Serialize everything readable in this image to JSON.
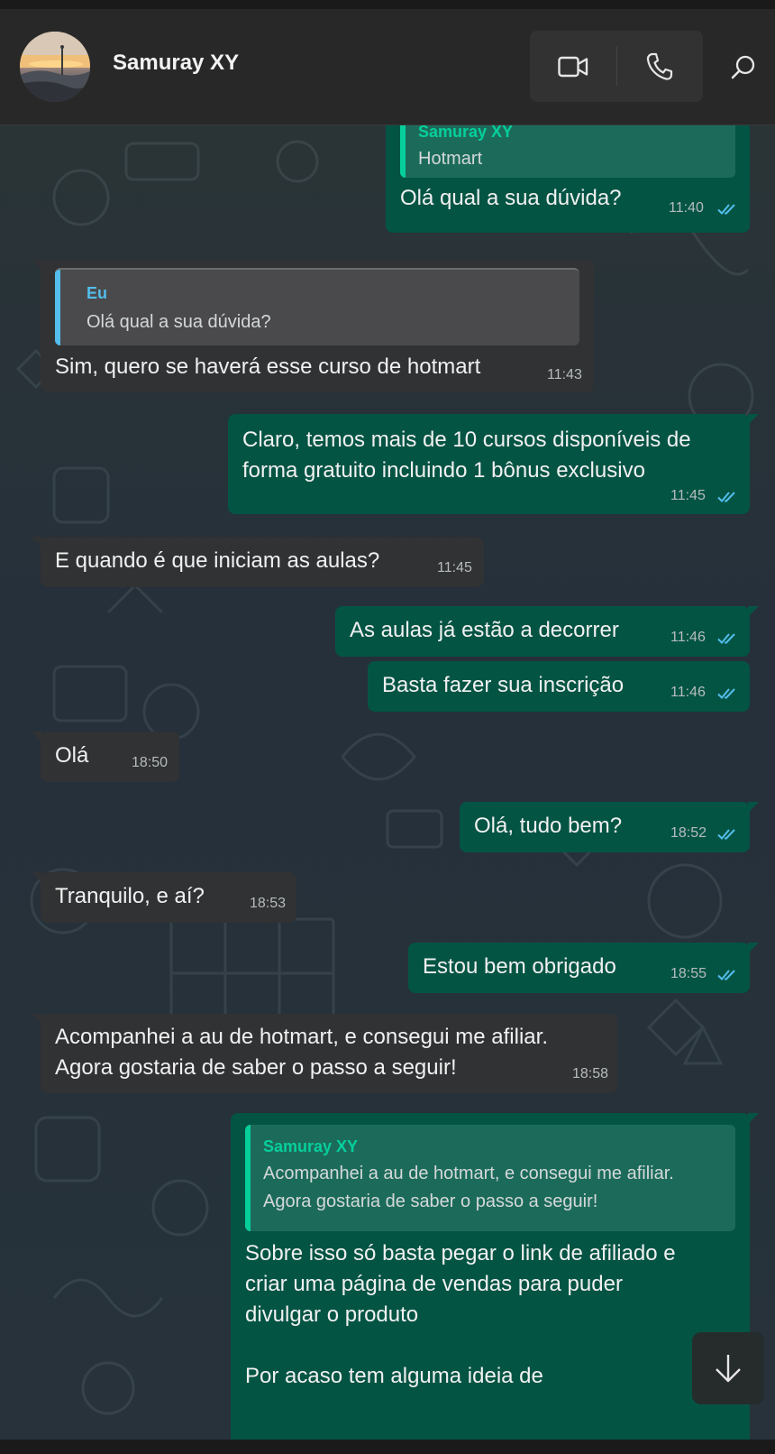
{
  "header": {
    "contact_name": "Samuray XY",
    "avatar_icon": "profile-photo",
    "video_icon": "video-camera-icon",
    "call_icon": "phone-icon",
    "search_icon": "search-icon"
  },
  "colors": {
    "incoming_bubble": "#313234",
    "outgoing_bubble": "#045444",
    "read_checks": "#53bdeb",
    "quote_name_out": "#06cf9c",
    "quote_name_in": "#53bdeb"
  },
  "messages": [
    {
      "dir": "out",
      "quote_name": "Samuray XY",
      "quote_text": "Hotmart",
      "text": "Olá qual a sua dúvida?",
      "time": "11:40",
      "read": true
    },
    {
      "dir": "in",
      "quote_name": "Eu",
      "quote_text": "Olá qual a sua dúvida?",
      "text": "Sim, quero se haverá esse curso de hotmart",
      "time": "11:43"
    },
    {
      "dir": "out",
      "text": "Claro, temos mais de 10 cursos disponíveis de\nforma gratuito incluindo 1 bônus exclusivo",
      "time": "11:45",
      "read": true
    },
    {
      "dir": "in",
      "text": "E quando é que iniciam as aulas?",
      "time": "11:45"
    },
    {
      "dir": "out",
      "text": "As aulas já estão a decorrer",
      "time": "11:46",
      "read": true
    },
    {
      "dir": "out",
      "text": "Basta fazer sua inscrição",
      "time": "11:46",
      "read": true
    },
    {
      "dir": "in",
      "text": "Olá",
      "time": "18:50"
    },
    {
      "dir": "out",
      "text": "Olá, tudo bem?",
      "time": "18:52",
      "read": true
    },
    {
      "dir": "in",
      "text": "Tranquilo, e aí?",
      "time": "18:53"
    },
    {
      "dir": "out",
      "text": "Estou bem obrigado",
      "time": "18:55",
      "read": true
    },
    {
      "dir": "in",
      "text": "Acompanhei a au de hotmart, e consegui me afiliar.\nAgora gostaria de saber o passo a seguir!",
      "time": "18:58"
    },
    {
      "dir": "out",
      "quote_name": "Samuray XY",
      "quote_text": "Acompanhei a au de hotmart, e consegui me afiliar.\nAgora gostaria de saber o passo a seguir!",
      "text": "Sobre isso só basta pegar o link de afiliado e\ncriar uma página de vendas para puder\ndivulgar o produto\n\nPor acaso tem alguma ideia de"
    }
  ],
  "reaction_bar": {
    "chevron_icon": "chevron-down-icon",
    "emoji_icon": "smiley-icon"
  },
  "scroll_button_icon": "arrow-down-icon"
}
